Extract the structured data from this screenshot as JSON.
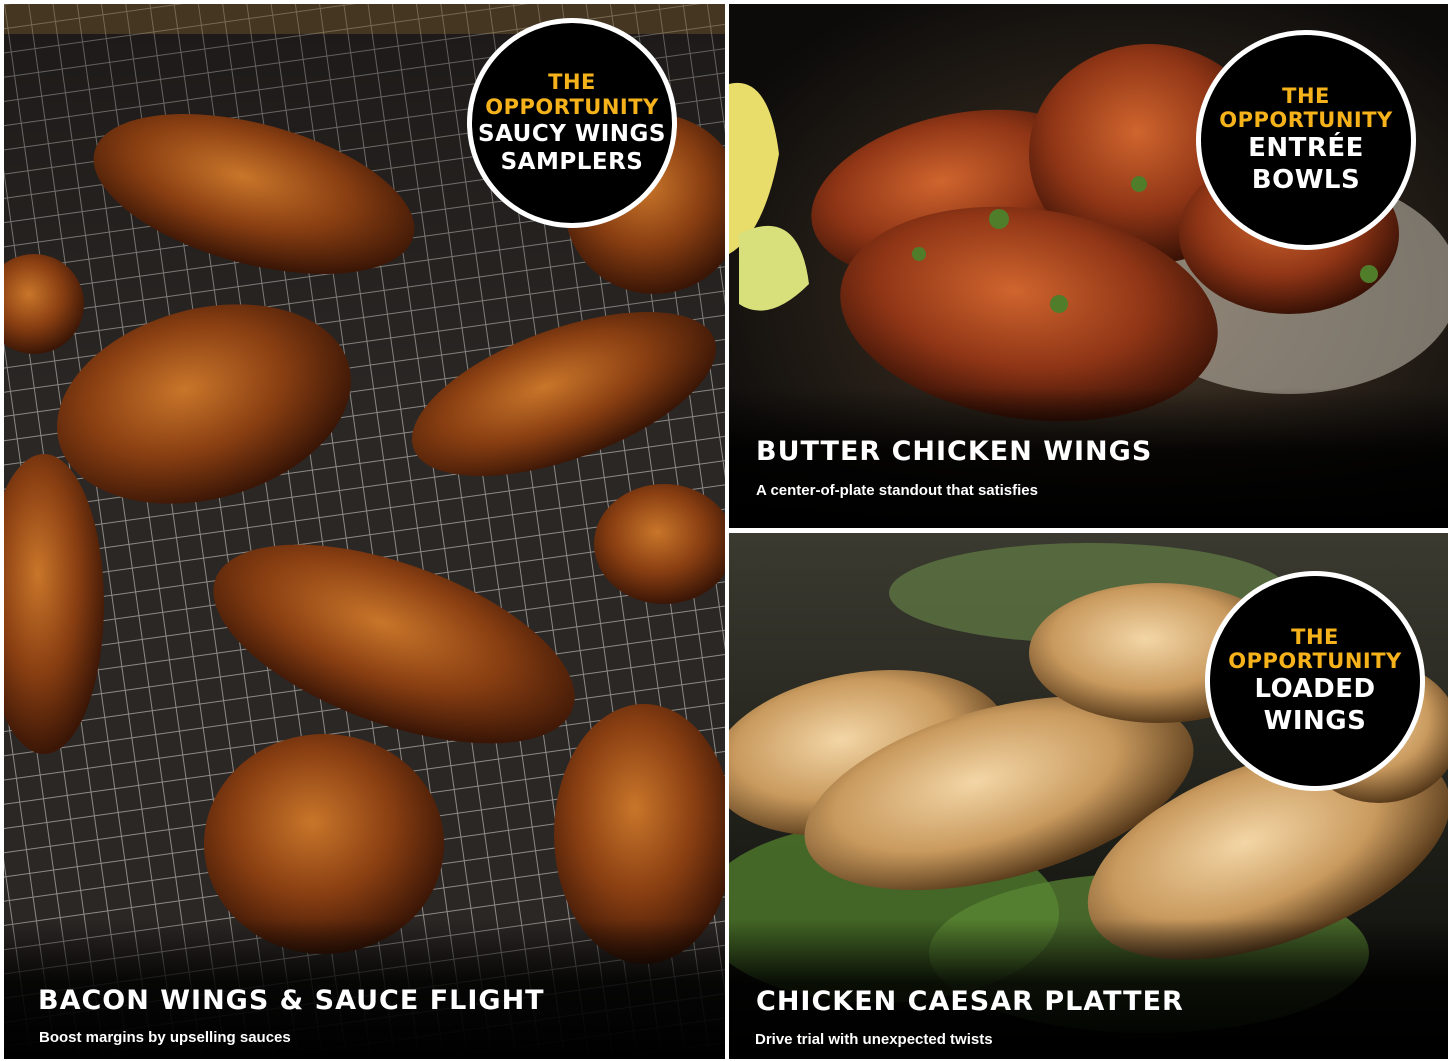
{
  "tiles": {
    "left": {
      "badge": {
        "line1": "THE",
        "line2": "OPPORTUNITY",
        "name1": "SAUCY WINGS",
        "name2": "SAMPLERS"
      },
      "title": "BACON WINGS & SAUCE FLIGHT",
      "subtitle": "Boost margins by upselling sauces"
    },
    "top_right": {
      "badge": {
        "line1": "THE",
        "line2": "OPPORTUNITY",
        "name1": "ENTRÉE",
        "name2": "BOWLS"
      },
      "title": "BUTTER CHICKEN WINGS",
      "subtitle": "A center-of-plate standout that satisfies"
    },
    "bottom_right": {
      "badge": {
        "line1": "THE",
        "line2": "OPPORTUNITY",
        "name1": "LOADED",
        "name2": "WINGS"
      },
      "title": "CHICKEN CAESAR PLATTER",
      "subtitle": "Drive trial with unexpected twists"
    }
  },
  "colors": {
    "accent": "#f6b21a",
    "caption_bg": "#000000",
    "text": "#ffffff"
  }
}
